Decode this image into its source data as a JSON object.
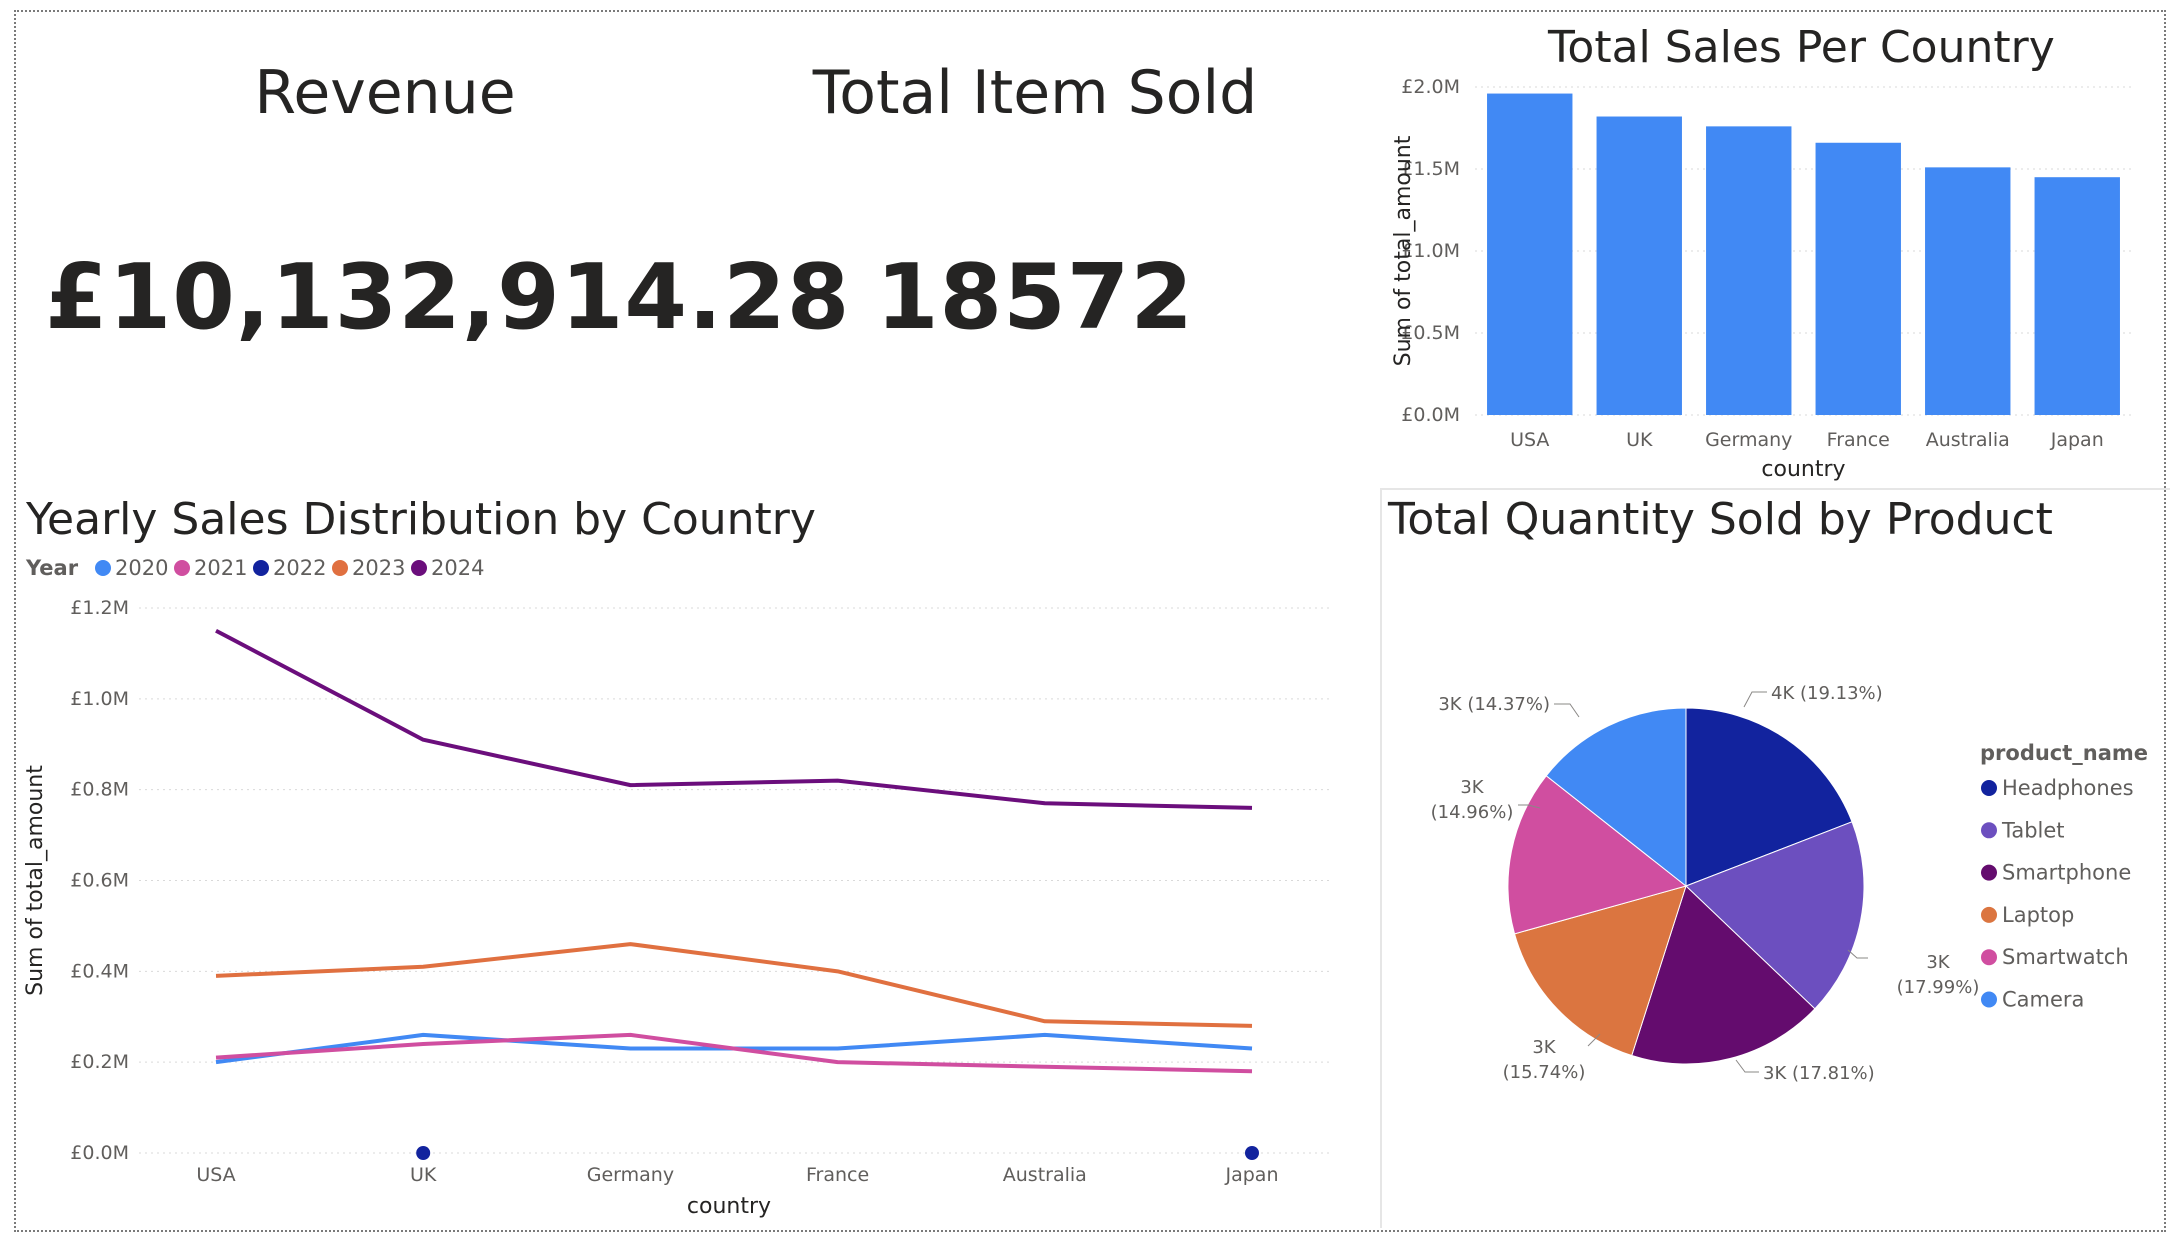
{
  "kpis": {
    "revenue_title": "Revenue",
    "revenue_value": "£10,132,914.28",
    "items_title": "Total Item Sold",
    "items_value": "18572"
  },
  "bar_chart": {
    "title": "Total Sales Per Country",
    "xlabel": "country",
    "ylabel": "Sum of total_amount",
    "y_ticks": [
      "£0.0M",
      "£0.5M",
      "£1.0M",
      "£1.5M",
      "£2.0M"
    ],
    "color": "#4189f4"
  },
  "line_chart": {
    "title": "Yearly Sales Distribution by Country",
    "legend_title": "Year",
    "xlabel": "country",
    "ylabel": "Sum of total_amount",
    "y_ticks": [
      "£0.0M",
      "£0.2M",
      "£0.4M",
      "£0.6M",
      "£0.8M",
      "£1.0M",
      "£1.2M"
    ]
  },
  "pie_chart": {
    "title": "Total Quantity Sold by Product",
    "legend_title": "product_name",
    "labels": {
      "Headphones": "4K (19.13%)",
      "Tablet_line1": "3K",
      "Tablet_line2": "(17.99%)",
      "Smartphone": "3K (17.81%)",
      "Laptop_line1": "3K",
      "Laptop_line2": "(15.74%)",
      "Smartwatch_line1": "3K",
      "Smartwatch_line2": "(14.96%)",
      "Camera": "3K (14.37%)"
    }
  },
  "chart_data": [
    {
      "type": "bar",
      "title": "Total Sales Per Country",
      "categories": [
        "USA",
        "UK",
        "Germany",
        "France",
        "Australia",
        "Japan"
      ],
      "values": [
        1.96,
        1.82,
        1.76,
        1.66,
        1.51,
        1.45
      ],
      "unit": "£M",
      "xlabel": "country",
      "ylabel": "Sum of total_amount",
      "ylim": [
        0,
        2.0
      ],
      "grid": true,
      "color": "#4189f4"
    },
    {
      "type": "line",
      "title": "Yearly Sales Distribution by Country",
      "categories": [
        "USA",
        "UK",
        "Germany",
        "France",
        "Australia",
        "Japan"
      ],
      "series": [
        {
          "name": "2020",
          "color": "#4189f4",
          "values": [
            0.2,
            0.26,
            0.23,
            0.23,
            0.26,
            0.23
          ]
        },
        {
          "name": "2021",
          "color": "#d04ea0",
          "values": [
            0.21,
            0.24,
            0.26,
            0.2,
            0.19,
            0.18
          ]
        },
        {
          "name": "2022",
          "color": "#12239e",
          "values": [
            null,
            0.0,
            null,
            null,
            null,
            0.0
          ]
        },
        {
          "name": "2023",
          "color": "#e07040",
          "values": [
            0.39,
            0.41,
            0.46,
            0.4,
            0.29,
            0.28
          ]
        },
        {
          "name": "2024",
          "color": "#6b0e7c",
          "values": [
            1.15,
            0.91,
            0.81,
            0.82,
            0.77,
            0.76
          ]
        }
      ],
      "unit": "£M",
      "xlabel": "country",
      "ylabel": "Sum of total_amount",
      "ylim": [
        0,
        1.2
      ],
      "legend_title": "Year",
      "legend_position": "top-left",
      "grid": true
    },
    {
      "type": "pie",
      "title": "Total Quantity Sold by Product",
      "legend_title": "product_name",
      "legend_position": "right",
      "slices": [
        {
          "name": "Headphones",
          "percent": 19.13,
          "label": "4K",
          "color": "#12239e"
        },
        {
          "name": "Tablet",
          "percent": 17.99,
          "label": "3K",
          "color": "#6c4fbf"
        },
        {
          "name": "Smartphone",
          "percent": 17.81,
          "label": "3K",
          "color": "#640c6e"
        },
        {
          "name": "Laptop",
          "percent": 15.74,
          "label": "3K",
          "color": "#db7540"
        },
        {
          "name": "Smartwatch",
          "percent": 14.96,
          "label": "3K",
          "color": "#d04ea0"
        },
        {
          "name": "Camera",
          "percent": 14.37,
          "label": "3K",
          "color": "#4189f4"
        }
      ]
    }
  ]
}
